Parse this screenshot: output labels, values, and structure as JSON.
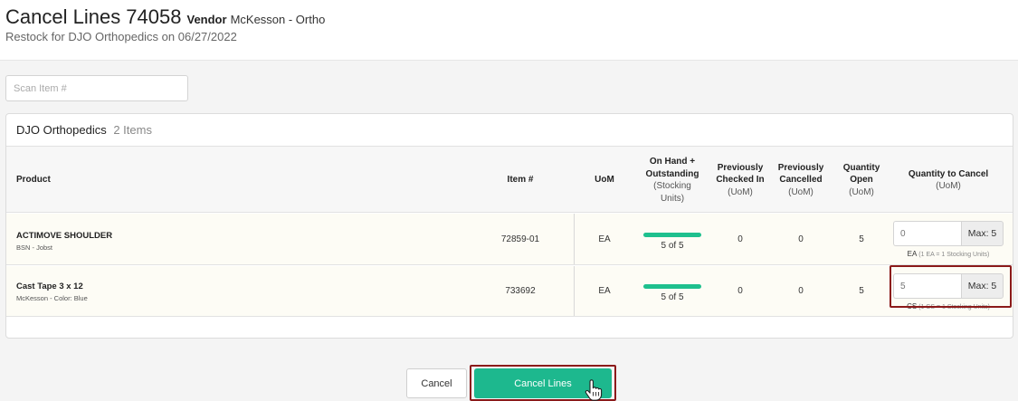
{
  "header": {
    "title": "Cancel Lines 74058",
    "vendor_label": "Vendor",
    "vendor_value": "McKesson - Ortho",
    "subtitle": "Restock for DJO Orthopedics on 06/27/2022"
  },
  "scan": {
    "placeholder": "Scan Item #"
  },
  "group": {
    "name": "DJO Orthopedics",
    "count": "2 Items",
    "columns": {
      "product": "Product",
      "item": "Item #",
      "uom": "UoM",
      "on_hand_l1": "On Hand +",
      "on_hand_l2": "Outstanding",
      "on_hand_l3": "(Stocking",
      "on_hand_l4": "Units)",
      "checked_l1": "Previously",
      "checked_l2": "Checked In",
      "checked_l3": "(UoM)",
      "cancelled_l1": "Previously",
      "cancelled_l2": "Cancelled",
      "cancelled_l3": "(UoM)",
      "open_l1": "Quantity",
      "open_l2": "Open",
      "open_l3": "(UoM)",
      "cancel_l1": "Quantity to Cancel",
      "cancel_l2": "(UoM)"
    },
    "rows": [
      {
        "product": "ACTIMOVE SHOULDER",
        "sub": "BSN - Jobst",
        "item": "72859-01",
        "uom": "EA",
        "on_hand_fraction": 1.0,
        "on_hand_text": "5 of 5",
        "checked_in": "0",
        "cancelled": "0",
        "open": "5",
        "qty_placeholder": "0",
        "max": "Max: 5",
        "note_unit": "EA",
        "note_detail": "(1 EA = 1 Stocking Units)"
      },
      {
        "product": "Cast Tape 3 x 12",
        "sub": "McKesson - Color: Blue",
        "item": "733692",
        "uom": "EA",
        "on_hand_fraction": 1.0,
        "on_hand_text": "5 of 5",
        "checked_in": "0",
        "cancelled": "0",
        "open": "5",
        "qty_placeholder": "5",
        "max": "Max: 5",
        "note_unit": "CS",
        "note_detail": "(1 CS = 1 Stocking Units)"
      }
    ]
  },
  "actions": {
    "cancel": "Cancel",
    "confirm": "Cancel Lines"
  },
  "colors": {
    "accent": "#1db88e",
    "progress": "#1ec08e",
    "highlight": "#8b1a1a"
  },
  "icons": {
    "cursor": "hand-pointer-icon"
  }
}
